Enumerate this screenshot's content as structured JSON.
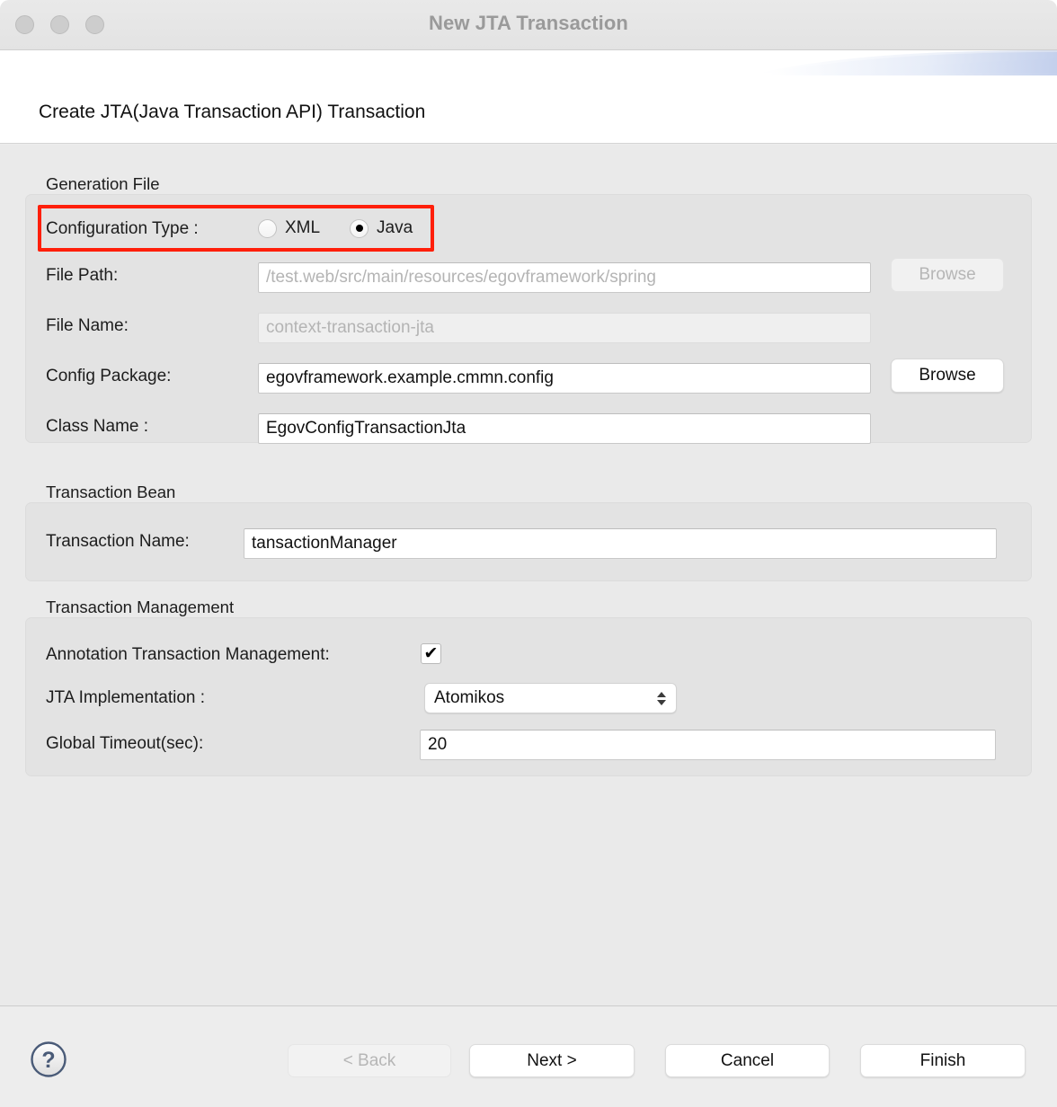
{
  "window": {
    "title": "New JTA Transaction",
    "traffic_lights": [
      "close-button",
      "minimize-button",
      "zoom-button"
    ]
  },
  "header": {
    "title": "Create JTA(Java Transaction API) Transaction"
  },
  "sections": {
    "generation_file": {
      "label": "Generation File",
      "configuration_type": {
        "label": "Configuration Type :",
        "options": [
          {
            "label": "XML",
            "selected": false
          },
          {
            "label": "Java",
            "selected": true
          }
        ]
      },
      "file_path": {
        "label": "File Path:",
        "value": "/test.web/src/main/resources/egovframework/spring",
        "disabled": true,
        "browse_label": "Browse",
        "browse_disabled": true
      },
      "file_name": {
        "label": "File Name:",
        "value": "context-transaction-jta",
        "disabled": true
      },
      "config_package": {
        "label": "Config Package:",
        "value": "egovframework.example.cmmn.config",
        "browse_label": "Browse",
        "browse_disabled": false
      },
      "class_name": {
        "label": "Class Name :",
        "value": "EgovConfigTransactionJta"
      }
    },
    "transaction_bean": {
      "label": "Transaction Bean",
      "transaction_name": {
        "label": "Transaction Name:",
        "value": "tansactionManager"
      }
    },
    "transaction_management": {
      "label": "Transaction Management",
      "annotation_transaction_management": {
        "label": "Annotation Transaction Management:",
        "checked": true,
        "check_glyph": "✔"
      },
      "jta_implementation": {
        "label": "JTA Implementation :",
        "value": "Atomikos"
      },
      "global_timeout": {
        "label": "Global Timeout(sec):",
        "value": "20"
      }
    }
  },
  "footer": {
    "help_icon": "question-mark-icon",
    "help_glyph": "?",
    "buttons": [
      {
        "label": "< Back",
        "disabled": true
      },
      {
        "label": "Next >",
        "disabled": false
      },
      {
        "label": "Cancel",
        "disabled": false
      },
      {
        "label": "Finish",
        "disabled": false
      }
    ]
  },
  "colors": {
    "annotation": "#ff1f0a",
    "titlebar_text": "#9a9a9a",
    "accent_swoosh": "#c6d2ee"
  }
}
